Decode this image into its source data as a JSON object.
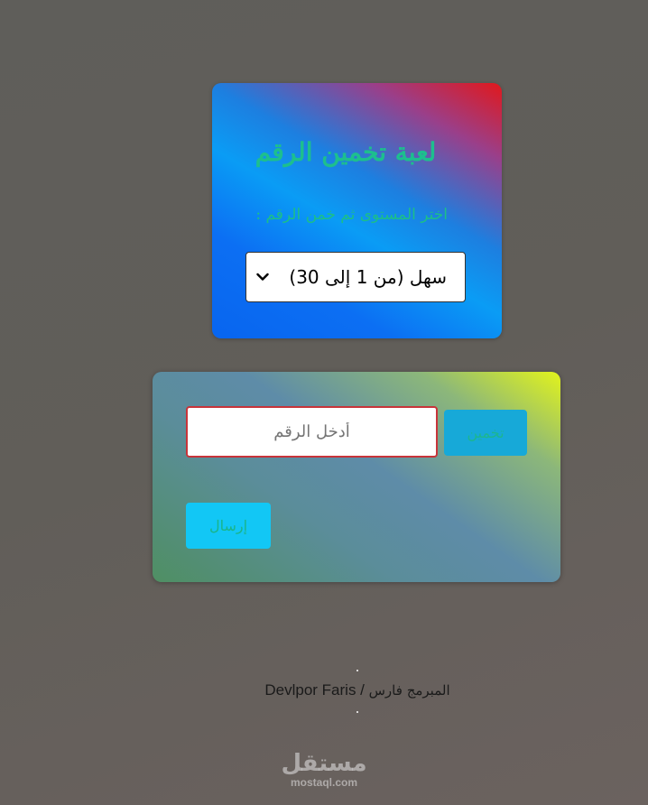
{
  "game_card": {
    "title": "لعبة تخمين الرقم",
    "subtitle": "اختر المستوى ثم خمن الرقم :",
    "level_select": {
      "selected": "سهل (من 1 إلى 30)"
    }
  },
  "guess_card": {
    "number_input": {
      "value": "",
      "placeholder": "أدخل الرقم"
    },
    "guess_button_label": "تخمين",
    "send_button_label": "إرسال"
  },
  "footer": {
    "developer_ar": "المبرمج فارس",
    "separator": " / ",
    "developer_en": "Devlpor Faris"
  },
  "watermark": {
    "arabic": "مستقل",
    "latin": "mostaql.com"
  },
  "colors": {
    "title_green": "#1dbf8e",
    "guess_button_bg": "#17a9d8",
    "send_button_bg": "#12c7f5",
    "input_border": "#c8343a"
  },
  "icons": {
    "select_arrow": "chevron-down-icon"
  }
}
